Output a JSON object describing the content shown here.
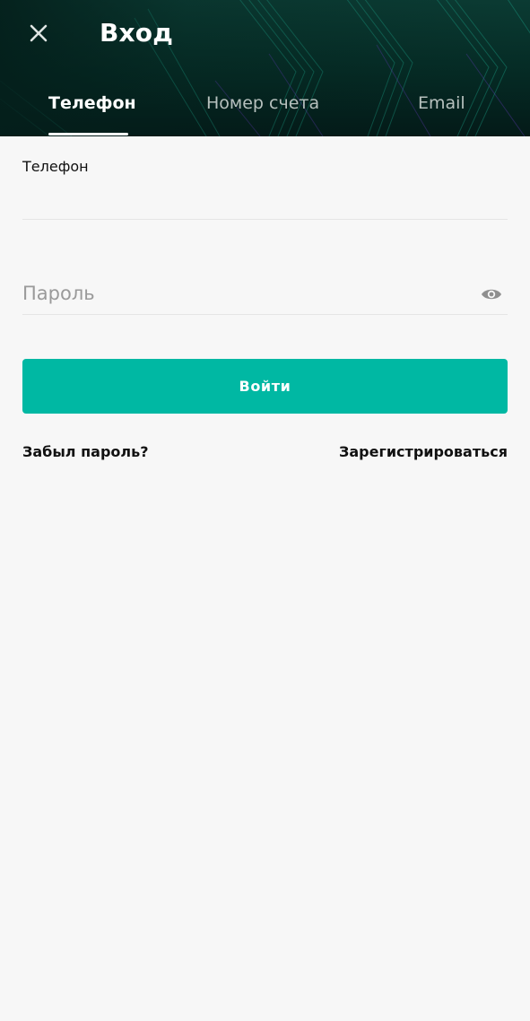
{
  "header": {
    "title": "Вход",
    "close_icon": "close-icon"
  },
  "tabs": [
    {
      "label": "Телефон",
      "active": true
    },
    {
      "label": "Номер счета",
      "active": false
    },
    {
      "label": "Email",
      "active": false
    }
  ],
  "form": {
    "phone": {
      "label": "Телефон",
      "value": ""
    },
    "password": {
      "placeholder": "Пароль",
      "value": "",
      "toggle_icon": "eye-icon"
    },
    "submit_label": "Войти"
  },
  "links": {
    "forgot": "Забыл пароль?",
    "register": "Зарегистрироваться"
  },
  "colors": {
    "accent": "#00b8a3",
    "header_bg": "#052a24",
    "page_bg": "#f7f7f7"
  }
}
